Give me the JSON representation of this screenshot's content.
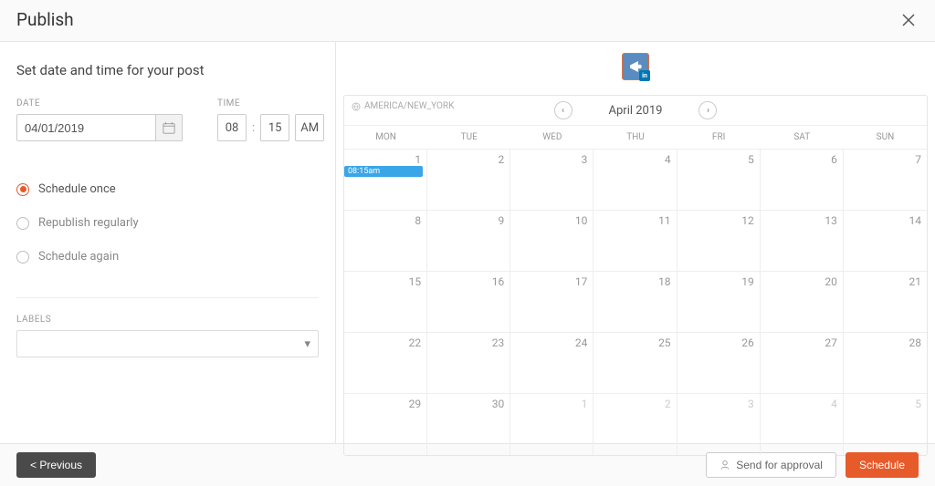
{
  "header": {
    "title": "Publish"
  },
  "left": {
    "subtitle": "Set date and time for your post",
    "date_label": "DATE",
    "time_label": "TIME",
    "date_value": "04/01/2019",
    "hour": "08",
    "minute": "15",
    "ampm": "AM",
    "radios": {
      "schedule_once": "Schedule once",
      "republish_regularly": "Republish regularly",
      "schedule_again": "Schedule again"
    },
    "labels_label": "LABELS",
    "labels_value": ""
  },
  "calendar": {
    "timezone": "AMERICA/NEW_YORK",
    "month": "April 2019",
    "dows": [
      "MON",
      "TUE",
      "WED",
      "THU",
      "FRI",
      "SAT",
      "SUN"
    ],
    "days": [
      [
        1,
        2,
        3,
        4,
        5,
        6,
        7
      ],
      [
        8,
        9,
        10,
        11,
        12,
        13,
        14
      ],
      [
        15,
        16,
        17,
        18,
        19,
        20,
        21
      ],
      [
        22,
        23,
        24,
        25,
        26,
        27,
        28
      ],
      [
        29,
        30,
        1,
        2,
        3,
        4,
        5
      ]
    ],
    "event": {
      "day": 1,
      "label": "08:15am"
    }
  },
  "footer": {
    "previous": "< Previous",
    "send_approval": "Send for approval",
    "schedule": "Schedule"
  }
}
